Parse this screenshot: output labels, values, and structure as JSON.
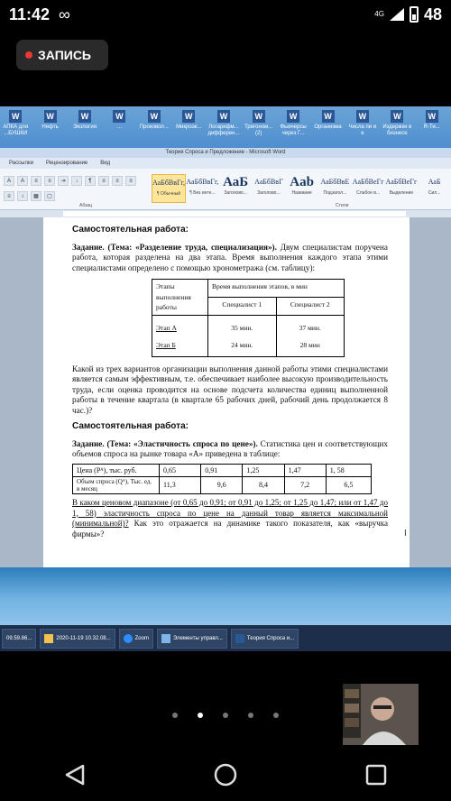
{
  "status_bar": {
    "time": "11:42",
    "network": "4G",
    "battery": "48"
  },
  "recording": {
    "label": "ЗАПИСЬ"
  },
  "desktop_icons": [
    "АПКА для ...БУШКИ",
    "Нефть",
    "Экология",
    "...",
    "Произвол...",
    "Микроэк...",
    "Логарифм... дифферен...",
    "Тригоном... (2)",
    "Фьючерсы через Г...",
    "Организма",
    "Числа пи и е",
    "Издержки в бизнесе",
    "R-Ти..."
  ],
  "window": {
    "title": "Теория Спроса и Предложение - Microsoft Word"
  },
  "ribbon": {
    "tabs": [
      "Рассылки",
      "Рецензирование",
      "Вид"
    ],
    "styles": [
      {
        "sample": "АаБбВвГг,",
        "name": "¶ Обычный"
      },
      {
        "sample": "АаБбВвГг,",
        "name": "¶ Без инте..."
      },
      {
        "sample": "АаБ",
        "name": "Заголово..."
      },
      {
        "sample": "АаБбВвГ",
        "name": "Заголово..."
      },
      {
        "sample": "Aab",
        "name": "Название"
      },
      {
        "sample": "АаБбВвЕ",
        "name": "Подзагол..."
      },
      {
        "sample": "АаБбВеГг",
        "name": "Слабое в..."
      },
      {
        "sample": "АаБбВеГг",
        "name": "Выделение"
      },
      {
        "sample": "АаБ",
        "name": "Сил..."
      }
    ],
    "group_paragraph": "Абзац",
    "group_styles": "Стили"
  },
  "document": {
    "h1": "Самостоятельная работа:",
    "task1_bold": "Задание.  (Тема: «Разделение труда, специализация»).",
    "task1_text": "Двум специалистам поручена работа, которая разделена на два этапа. Время выполнения каждого этапа этими специалистами определено с помощью хронометража (см. таблицу):",
    "table1": {
      "h_stage": "Этапы выполнения работы",
      "h_time": "Время выполнения этапов, в мин",
      "h_s1": "Специалист 1",
      "h_s2": "Специалист 2",
      "rows": [
        {
          "stage": "Этап А",
          "s1": "35 мин.",
          "s2": "37 мин."
        },
        {
          "stage": "Этап Б",
          "s1": "24 мин.",
          "s2": "28 мин"
        }
      ]
    },
    "q1": "Какой из трех вариантов организации выполнения данной работы этими специалистами является самым эффективным, т.е. обеспечивает наиболее высокую производительность труда, если оценка проводится на основе подсчета количества единиц выполненной работы в течение квартала (в квартале 65 рабочих дней, рабочий день продолжается 8 час.)?",
    "h2": "Самостоятельная работа:",
    "task2_bold": "Задание.  (Тема: «Эластичность спроса по цене»).",
    "task2_text": "Статистика цен и соответствующих объемов спроса на рынке товара «А» приведена в таблице:",
    "table2": {
      "row1_label": "Цена (Pᴬ), тыс. руб.",
      "row1": [
        "0,65",
        "0,91",
        "1,25",
        "1,47",
        "1, 58"
      ],
      "row2_label": "Объем спроса (Qᴬ), Тыс. ед. в месяц",
      "row2": [
        "11,3",
        "9,6",
        "8,4",
        "7,2",
        "6,5"
      ]
    },
    "q2_underlined": "В каком ценовом диапазоне (от 0,65 до 0,91; от 0,91 до 1,25; от 1,25 до 1,47; или от 1,47 до 1, 58)  эластичность спроса по цене на данный товар является максимальной (минимальной)?",
    "q2_rest": " Как это отражается на динамике такого показателя, как «выручка фирмы»?"
  },
  "taskbar": {
    "items": [
      "09.59.86...",
      "2020-11-19 10.32.08...",
      "Zoom",
      "Элементы управл...",
      "Теория Спроса и..."
    ]
  }
}
